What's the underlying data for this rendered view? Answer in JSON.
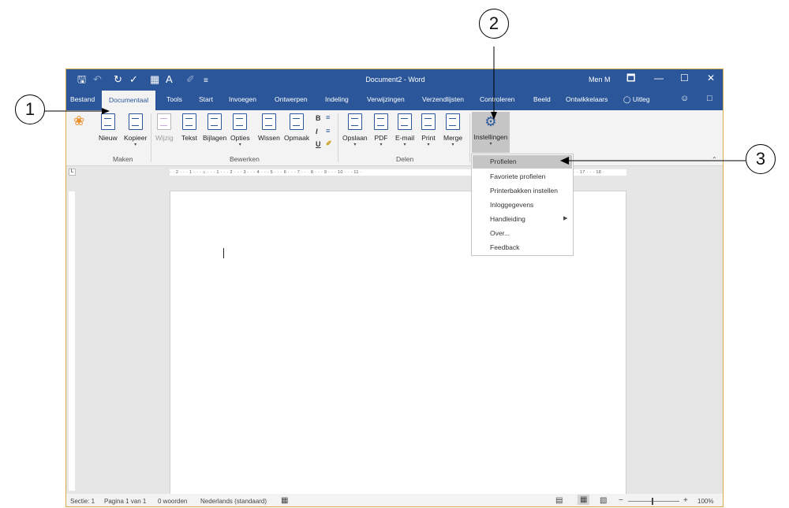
{
  "window": {
    "title": "Document2 - Word",
    "user": "Men M",
    "controls": [
      "🗖",
      "—",
      "☐",
      "✕"
    ]
  },
  "quick_access": [
    "save-icon",
    "undo-icon",
    "redo-icon",
    "spelling-icon",
    "table-icon",
    "font-color-icon",
    "format-painter-icon",
    "customize-icon"
  ],
  "tabs": {
    "items": [
      "Bestand",
      "Documentaal",
      "Tools",
      "Start",
      "Invoegen",
      "Ontwerpen",
      "Indeling",
      "Verwijzingen",
      "Verzendlijsten",
      "Controleren",
      "Beeld",
      "Ontwikkelaars"
    ],
    "active": "Documentaal",
    "tell_me": "Uitleg"
  },
  "ribbon": {
    "groups": [
      "Maken",
      "Bewerken",
      "Delen"
    ],
    "maken": [
      "Nieuw",
      "Kopieer"
    ],
    "bewerken": [
      "Wijzig",
      "Tekst",
      "Bijlagen",
      "Opties",
      "Wissen",
      "Opmaak"
    ],
    "format_buttons": [
      "B",
      "I",
      "U"
    ],
    "delen": [
      "Opslaan",
      "PDF",
      "E-mail",
      "Print",
      "Merge"
    ],
    "settings": "Instellingen"
  },
  "ruler": {
    "horizontal": "· · 2 · · · 1 · · · ⌂ · · · 1 · · · 2 · · · 3 · · · 4 · · · 5 · · · 6 · · · 7 · · · 8 · · · 9 · · · 10 · · · 11 ·",
    "horizontal_right": "· · 17 · · · 18 ·"
  },
  "dropdown": {
    "items": [
      "Profielen",
      "Favoriete profielen",
      "Printerbakken instellen",
      "Inloggegevens",
      "Handleiding",
      "Over...",
      "Feedback"
    ],
    "highlighted": "Profielen"
  },
  "status": {
    "section": "Sectie: 1",
    "page": "Pagina 1 van 1",
    "words": "0 woorden",
    "language": "Nederlands (standaard)",
    "zoom": "100%",
    "zoom_minus": "−",
    "zoom_plus": "+"
  },
  "callouts": [
    "1",
    "2",
    "3"
  ],
  "colors": {
    "word_blue": "#2b579a",
    "ribbon_bg": "#f3f3f3",
    "menu_highlight": "#c5c5c5"
  }
}
